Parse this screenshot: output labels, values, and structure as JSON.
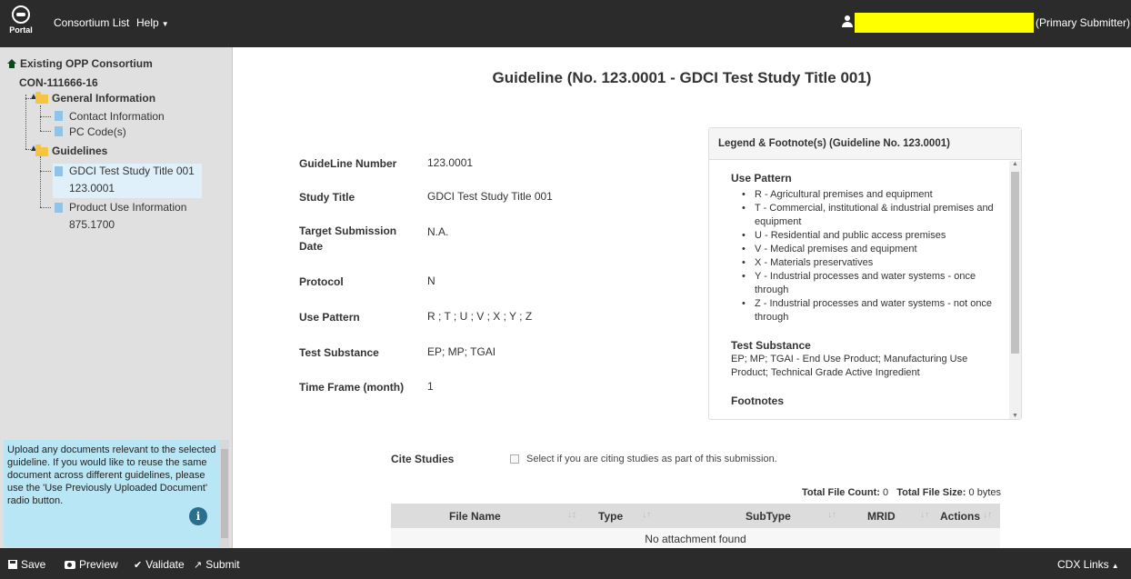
{
  "nav": {
    "logo_text": "Portal",
    "consortium_list": "Consortium List",
    "help": "Help",
    "user_role": "(Primary Submitter)"
  },
  "sidebar": {
    "root_label": "Existing OPP Consortium",
    "consortium_id": "CON-111666-16",
    "general_info": "General Information",
    "contact_info": "Contact Information",
    "pc_codes": "PC Code(s)",
    "guidelines": "Guidelines",
    "guideline_1_title": "GDCI Test Study Title 001",
    "guideline_1_number": "123.0001",
    "guideline_2_title": "Product Use Information",
    "guideline_2_number": "875.1700",
    "help_text": "Upload any documents relevant to the selected guideline. If you would like to reuse the same document across different guidelines, please use the 'Use Previously Uploaded Document' radio button."
  },
  "main": {
    "title": "Guideline (No. 123.0001 - GDCI Test Study Title 001)",
    "fields": [
      {
        "label": "GuideLine Number",
        "value": "123.0001"
      },
      {
        "label": "Study Title",
        "value": "GDCI Test Study Title 001"
      },
      {
        "label": "Target Submission Date",
        "value": "N.A."
      },
      {
        "label": "Protocol",
        "value": "N"
      },
      {
        "label": "Use Pattern",
        "value": "R ; T ; U ; V ; X ; Y ; Z"
      },
      {
        "label": "Test Substance",
        "value": "EP; MP; TGAI"
      },
      {
        "label": "Time Frame (month)",
        "value": "1"
      }
    ],
    "legend": {
      "title": "Legend & Footnote(s) (Guideline No. 123.0001)",
      "use_pattern_heading": "Use Pattern",
      "use_patterns": [
        "R - Agricultural premises and equipment",
        "T - Commercial, institutional & industrial premises and equipment",
        "U - Residential and public access premises",
        "V - Medical premises and equipment",
        "X - Materials preservatives",
        "Y - Industrial processes and water systems - once through",
        "Z - Industrial processes and water systems - not once through"
      ],
      "test_substance_heading": "Test Substance",
      "test_substance_text": "EP; MP; TGAI - End Use Product; Manufacturing Use Product; Technical Grade Active Ingredient",
      "footnotes_heading": "Footnotes"
    },
    "cite_studies_label": "Cite Studies",
    "cite_studies_text": "Select if you are citing studies as part of this submission.",
    "total_file_count_label": "Total File Count:",
    "total_file_count": "0",
    "total_file_size_label": "Total File Size:",
    "total_file_size": "0 bytes",
    "table": {
      "columns": [
        "File Name",
        "Type",
        "SubType",
        "MRID",
        "Actions"
      ],
      "empty": "No attachment found"
    }
  },
  "toolbar": {
    "save": "Save",
    "preview": "Preview",
    "validate": "Validate",
    "submit": "Submit",
    "cdx_links": "CDX Links"
  }
}
